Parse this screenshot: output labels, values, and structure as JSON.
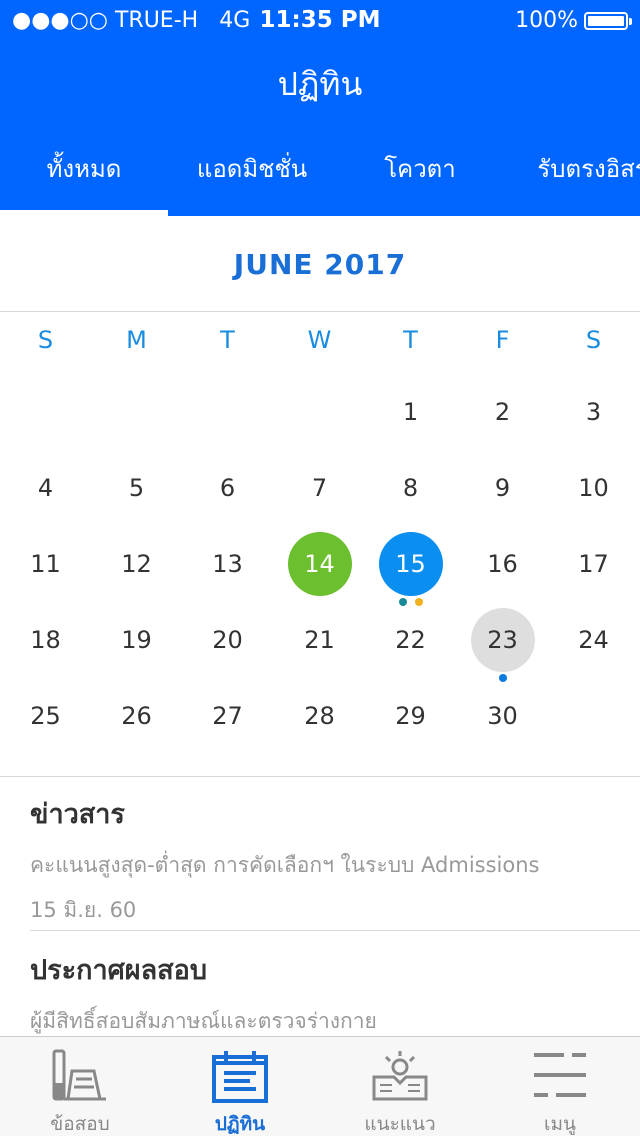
{
  "status": {
    "signal": "●●●○○",
    "carrier": "TRUE-H",
    "network": "4G",
    "time": "11:35 PM",
    "battery": "100%"
  },
  "header": {
    "title": "ปฏิทิน"
  },
  "tabs": [
    {
      "label": "ทั้งหมด",
      "active": true
    },
    {
      "label": "แอดมิชชั่น",
      "active": false
    },
    {
      "label": "โควตา",
      "active": false
    },
    {
      "label": "รับตรงอิสระ",
      "active": false
    }
  ],
  "calendar": {
    "month_label": "JUNE 2017",
    "weekdays": [
      "S",
      "M",
      "T",
      "W",
      "T",
      "F",
      "S"
    ],
    "days": [
      {
        "d": "1"
      },
      {
        "d": "2"
      },
      {
        "d": "3"
      },
      {
        "d": "4"
      },
      {
        "d": "5"
      },
      {
        "d": "6"
      },
      {
        "d": "7"
      },
      {
        "d": "8"
      },
      {
        "d": "9"
      },
      {
        "d": "10"
      },
      {
        "d": "11"
      },
      {
        "d": "12"
      },
      {
        "d": "13"
      },
      {
        "d": "14",
        "highlight": "green"
      },
      {
        "d": "15",
        "highlight": "blue",
        "dots": [
          "#1a8a9a",
          "#f0b020"
        ]
      },
      {
        "d": "16"
      },
      {
        "d": "17"
      },
      {
        "d": "18"
      },
      {
        "d": "19"
      },
      {
        "d": "20"
      },
      {
        "d": "21"
      },
      {
        "d": "22"
      },
      {
        "d": "23",
        "highlight": "gray",
        "dots": [
          "#0a7be0"
        ]
      },
      {
        "d": "24"
      },
      {
        "d": "25"
      },
      {
        "d": "26"
      },
      {
        "d": "27"
      },
      {
        "d": "28"
      },
      {
        "d": "29"
      },
      {
        "d": "30"
      }
    ]
  },
  "news": [
    {
      "title": "ข่าวสาร",
      "line1": "คะแนนสูงสุด-ต่ำสุด การคัดเลือกฯ ในระบบ Admissions",
      "line2": "15 มิ.ย. 60"
    },
    {
      "title": "ประกาศผลสอบ",
      "line1": "ผู้มีสิทธิ์สอบสัมภาษณ์และตรวจร่างกาย"
    }
  ],
  "tabbar": [
    {
      "label": "ข้อสอบ",
      "icon": "exam-icon",
      "active": false
    },
    {
      "label": "ปฏิทิน",
      "icon": "calendar-icon",
      "active": true
    },
    {
      "label": "แนะแนว",
      "icon": "guidance-icon",
      "active": false
    },
    {
      "label": "เมนู",
      "icon": "menu-icon",
      "active": false
    }
  ],
  "colors": {
    "primary": "#0066ff",
    "green": "#6cbf2e",
    "blue": "#0a8ef0",
    "gray": "#dedede"
  }
}
